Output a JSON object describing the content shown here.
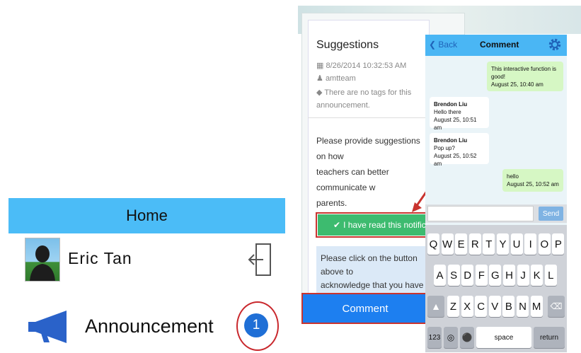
{
  "home": {
    "title": "Home",
    "user_name": "Eric  Tan",
    "announcement_label": "Announcement",
    "announcement_count": "1"
  },
  "suggestion": {
    "title": "Suggestions",
    "date": "8/26/2014 10:32:53 AM",
    "author": "amtteam",
    "tags": "There are no tags for this announcement.",
    "body": "Please provide suggestions on how\nteachers can better communicate w\nparents.",
    "read_button": "I have read this notification",
    "instructions": "Please click on the button above to\nacknowledge that you have read this\nmessage.",
    "comment_button": "Comment"
  },
  "chat": {
    "back": "Back",
    "title": "Comment",
    "messages": [
      {
        "sender": "",
        "text": "This interactive function is good!",
        "time": "August 25, 10:40 am"
      },
      {
        "sender": "Brendon Liu",
        "text": "Hello there",
        "time": "August 25, 10:51 am"
      },
      {
        "sender": "Brendon Liu",
        "text": "Pop up?",
        "time": "August 25, 10:52 am"
      },
      {
        "sender": "",
        "text": "hello",
        "time": "August 25, 10:52 am"
      }
    ],
    "input_value": "",
    "send": "Send"
  },
  "keyboard": {
    "row1": [
      "Q",
      "W",
      "E",
      "R",
      "T",
      "Y",
      "U",
      "I",
      "O",
      "P"
    ],
    "row2": [
      "A",
      "S",
      "D",
      "F",
      "G",
      "H",
      "J",
      "K",
      "L"
    ],
    "row3": [
      "Z",
      "X",
      "C",
      "V",
      "B",
      "N",
      "M"
    ],
    "numbers": "123",
    "space": "space",
    "return": "return"
  },
  "colors": {
    "home_bar": "#4bbcf7",
    "badge": "#1f6fd6",
    "highlight": "#c9342f",
    "read_button": "#3dbb6f",
    "comment_button": "#1d7ff0",
    "nav_bar": "#4ab6f4",
    "sent_bubble": "#d6f7c4"
  },
  "icons": {
    "logout": "logout-icon",
    "announcement": "megaphone-icon",
    "settings": "gear-icon",
    "calendar": "calendar-icon",
    "user": "user-icon",
    "tag": "tag-icon",
    "check": "check-circle-icon",
    "shift": "shift-icon",
    "backspace": "backspace-icon",
    "globe": "globe-icon",
    "mic": "microphone-icon"
  }
}
